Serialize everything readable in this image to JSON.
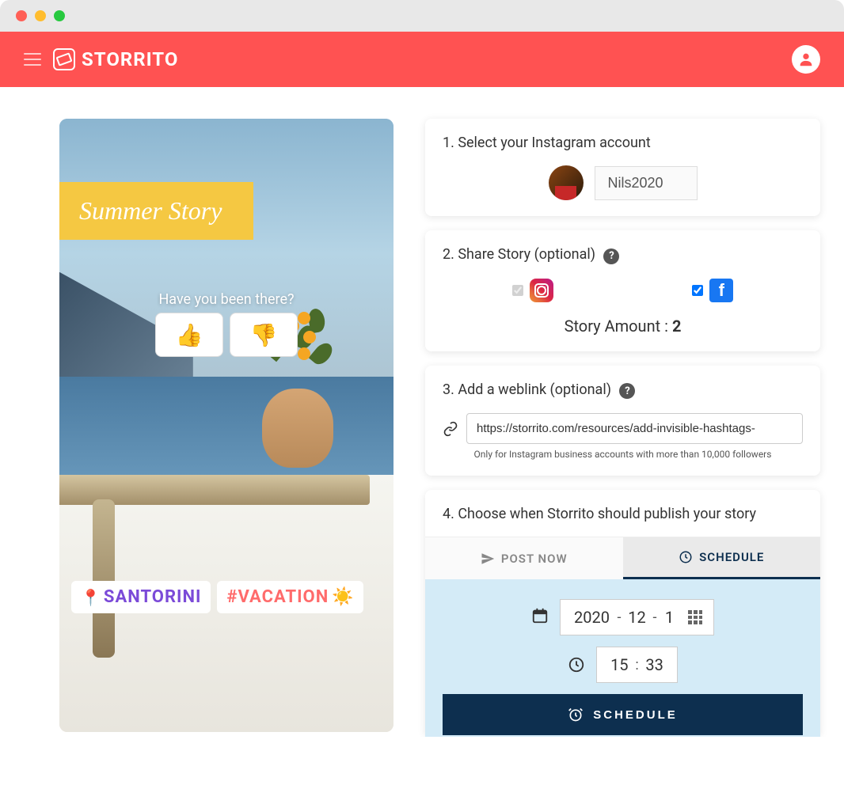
{
  "brand": "STORRITO",
  "story_preview": {
    "banner": "Summer Story",
    "poll_question": "Have you been there?",
    "location_tag": "SANTORINI",
    "hashtag": "#VACATION"
  },
  "section1": {
    "title": "1. Select your Instagram account",
    "account_name": "Nils2020"
  },
  "section2": {
    "title": "2. Share Story (optional)",
    "instagram_checked": true,
    "facebook_checked": true,
    "amount_label": "Story Amount : ",
    "amount_value": "2"
  },
  "section3": {
    "title": "3. Add a weblink (optional)",
    "url": "https://storrito.com/resources/add-invisible-hashtags-",
    "note": "Only for Instagram business accounts with more than 10,000 followers"
  },
  "section4": {
    "title": "4. Choose when Storrito should publish your story",
    "tab_post_now": "POST NOW",
    "tab_schedule": "SCHEDULE",
    "date_year": "2020",
    "date_month": "12",
    "date_day": "1",
    "time_hour": "15",
    "time_min": "33",
    "button": "SCHEDULE"
  }
}
